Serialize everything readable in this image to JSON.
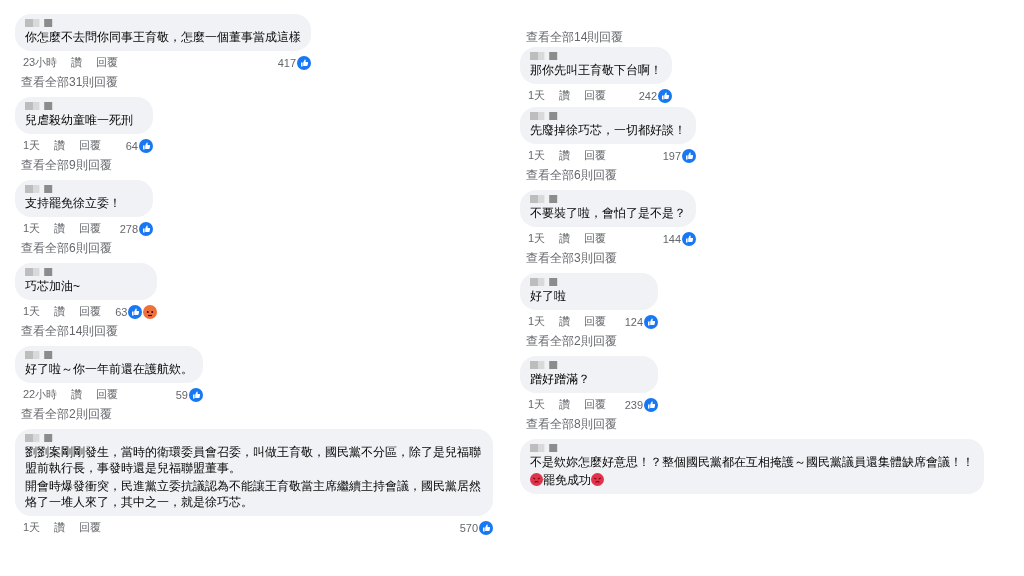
{
  "columns": [
    {
      "comments": [
        {
          "paragraphs": [
            {
              "kind": "plain",
              "text": "你怎麼不去問你同事王育敬，怎麼一個董事當成這樣"
            }
          ],
          "time": "23小時",
          "like_label": "讚",
          "reply_label": "回覆",
          "count": "417",
          "reactions": [
            {
              "kind": "like"
            }
          ],
          "replies": "查看全部31則回覆"
        },
        {
          "paragraphs": [
            {
              "kind": "plain",
              "text": "兒虐殺幼童唯一死刑"
            }
          ],
          "time": "1天",
          "like_label": "讚",
          "reply_label": "回覆",
          "count": "64",
          "reactions": [
            {
              "kind": "like"
            }
          ],
          "replies": "查看全部9則回覆"
        },
        {
          "paragraphs": [
            {
              "kind": "plain",
              "text": "支持罷免徐立委！"
            }
          ],
          "time": "1天",
          "like_label": "讚",
          "reply_label": "回覆",
          "count": "278",
          "reactions": [
            {
              "kind": "like"
            }
          ],
          "replies": "查看全部6則回覆"
        },
        {
          "paragraphs": [
            {
              "kind": "plain",
              "text": "巧芯加油~"
            }
          ],
          "time": "1天",
          "like_label": "讚",
          "reply_label": "回覆",
          "count": "63",
          "reactions": [
            {
              "kind": "like"
            },
            {
              "kind": "angry"
            }
          ],
          "replies": "查看全部14則回覆"
        },
        {
          "paragraphs": [
            {
              "kind": "plain",
              "text": "好了啦～你一年前還在護航欸。"
            }
          ],
          "time": "22小時",
          "like_label": "讚",
          "reply_label": "回覆",
          "count": "59",
          "reactions": [
            {
              "kind": "like"
            }
          ],
          "replies": "查看全部2則回覆"
        },
        {
          "paragraphs": [
            {
              "kind": "plain",
              "text": "劉劉案剛剛發生，當時的衛環委員會召委，叫做王育敬，國民黨不分區，除了是兒福聯盟前執行長，事發時還是兒福聯盟董事。"
            },
            {
              "kind": "plain",
              "text": "開會時爆發衝突，民進黨立委抗議認為不能讓王育敬當主席繼續主持會議，國民黨居然烙了一堆人來了，其中之一，就是徐巧芯。"
            }
          ],
          "time": "1天",
          "like_label": "讚",
          "reply_label": "回覆",
          "count": "570",
          "reactions": [
            {
              "kind": "like"
            }
          ]
        }
      ]
    },
    {
      "top_replies": "查看全部14則回覆",
      "comments": [
        {
          "paragraphs": [
            {
              "kind": "plain",
              "text": "那你先叫王育敬下台啊！"
            }
          ],
          "time": "1天",
          "like_label": "讚",
          "reply_label": "回覆",
          "count": "242",
          "reactions": [
            {
              "kind": "like"
            }
          ]
        },
        {
          "paragraphs": [
            {
              "kind": "plain",
              "text": "先廢掉徐巧芯，一切都好談！"
            }
          ],
          "time": "1天",
          "like_label": "讚",
          "reply_label": "回覆",
          "count": "197",
          "reactions": [
            {
              "kind": "like"
            }
          ],
          "replies": "查看全部6則回覆"
        },
        {
          "paragraphs": [
            {
              "kind": "plain",
              "text": "不要裝了啦，會怕了是不是？"
            }
          ],
          "time": "1天",
          "like_label": "讚",
          "reply_label": "回覆",
          "count": "144",
          "reactions": [
            {
              "kind": "like"
            }
          ],
          "replies": "查看全部3則回覆"
        },
        {
          "paragraphs": [
            {
              "kind": "plain",
              "text": "好了啦"
            }
          ],
          "time": "1天",
          "like_label": "讚",
          "reply_label": "回覆",
          "count": "124",
          "reactions": [
            {
              "kind": "like"
            }
          ],
          "replies": "查看全部2則回覆"
        },
        {
          "paragraphs": [
            {
              "kind": "plain",
              "text": "蹭好蹭滿？"
            }
          ],
          "time": "1天",
          "like_label": "讚",
          "reply_label": "回覆",
          "count": "239",
          "reactions": [
            {
              "kind": "like"
            }
          ],
          "replies": "查看全部8則回覆"
        },
        {
          "paragraphs": [
            {
              "kind": "plain",
              "text": "不是欸妳怎麼好意思！？整個國民黨都在互相掩護～國民黨議員還集體缺席會議！！"
            },
            {
              "kind": "emoji_wrapped",
              "text": "罷免成功"
            }
          ]
        }
      ]
    }
  ]
}
